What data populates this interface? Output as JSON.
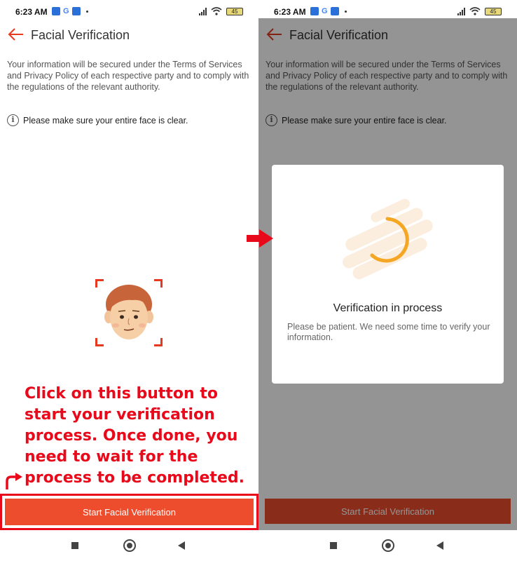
{
  "left_screen": {
    "status": {
      "time": "6:23 AM",
      "battery": "45"
    },
    "header": {
      "title": "Facial Verification"
    },
    "info": "Your information will be secured under the Terms of Services and Privacy Policy of each respective party and to comply with the regulations of the relevant authority.",
    "hint": "Please make sure your entire face is clear.",
    "annotation": "Click on this button to start your verification process. Once done, you need to wait for the process to be completed.",
    "button_label": "Start Facial Verification"
  },
  "right_screen": {
    "status": {
      "time": "6:23 AM",
      "battery": "45"
    },
    "header": {
      "title": "Facial Verification"
    },
    "info": "Your information will be secured under the Terms of Services and Privacy Policy of each respective party and to comply with the regulations of the relevant authority.",
    "hint": "Please make sure your entire face is clear.",
    "modal": {
      "title": "Verification in process",
      "message": "Please be patient. We need some time to verify your information."
    },
    "button_label": "Start Facial Verification"
  },
  "colors": {
    "accent": "#ee4d2d",
    "annotation": "#e8091a",
    "spinner": "#f5a623"
  },
  "icons": [
    "back-arrow-icon",
    "info-icon",
    "face-illustration",
    "spinner-icon",
    "red-arrow-icon",
    "curved-arrow-icon"
  ]
}
